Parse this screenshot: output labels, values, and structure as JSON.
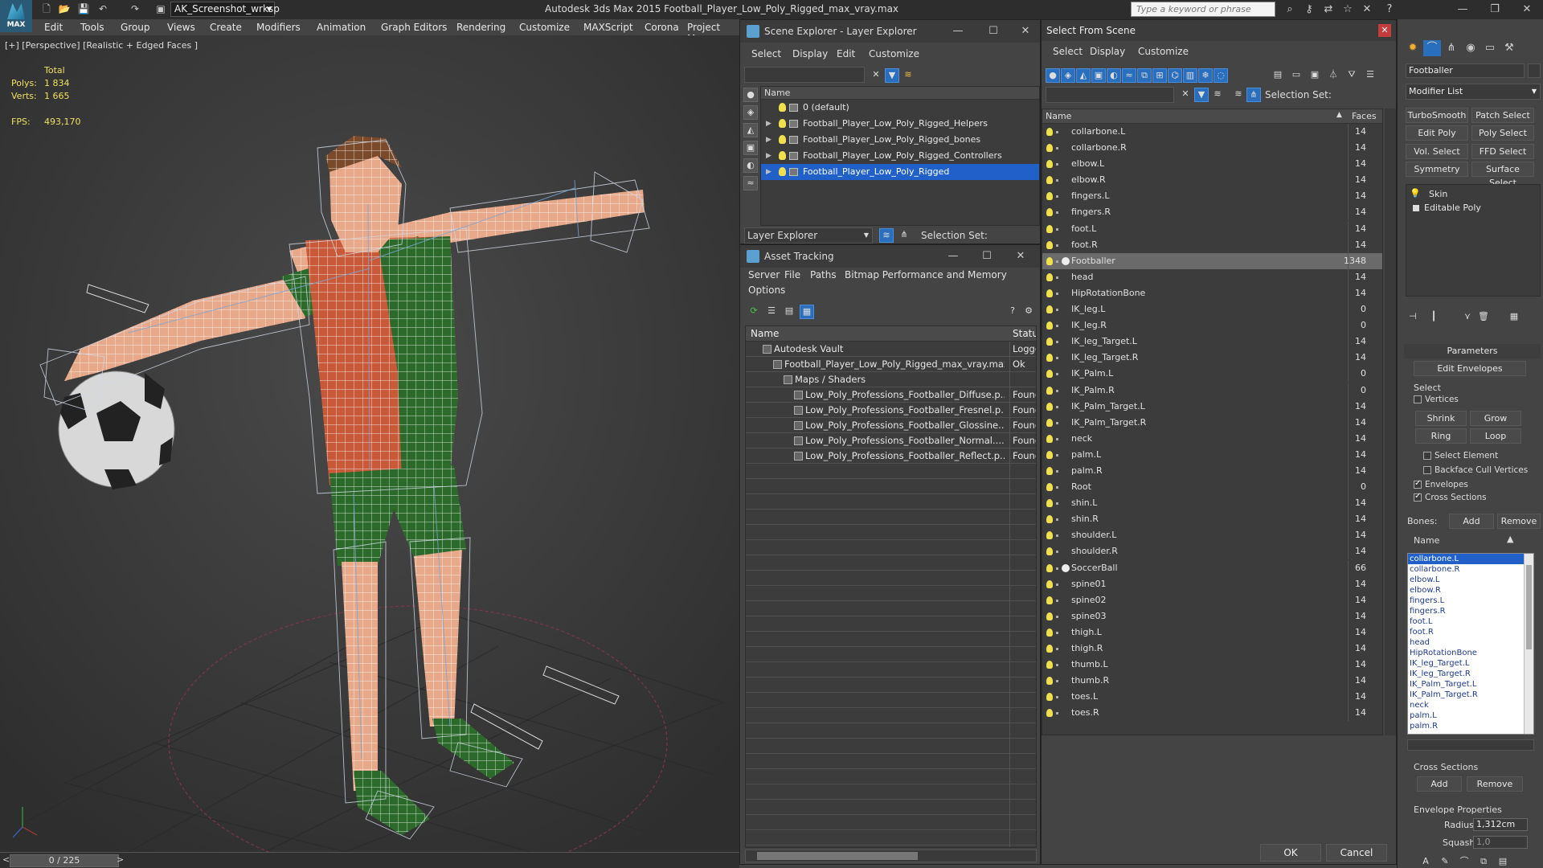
{
  "titlebar": {
    "logo_text": "MAX",
    "workspace": "AK_Screenshot_wrksp",
    "app_title": "Autodesk 3ds Max  2015     Football_Player_Low_Poly_Rigged_max_vray.max",
    "search_placeholder": "Type a keyword or phrase",
    "icons": [
      "binoculars-icon",
      "key-icon",
      "sign-in-icon",
      "star-icon",
      "x-icon",
      "help-icon"
    ],
    "window_controls": [
      "minimize",
      "restore",
      "close"
    ]
  },
  "menubar": [
    "Edit",
    "Tools",
    "Group",
    "Views",
    "Create",
    "Modifiers",
    "Animation",
    "Graph Editors",
    "Rendering",
    "Customize",
    "MAXScript",
    "Corona",
    "Project Man"
  ],
  "viewport": {
    "label": "[+] [Perspective] [Realistic + Edged Faces ]",
    "stats_total": "Total",
    "polys_label": "Polys:",
    "polys_value": "1 834",
    "verts_label": "Verts:",
    "verts_value": "1 665",
    "fps_label": "FPS:",
    "fps_value": "493,170"
  },
  "timeline": {
    "frame": "0 / 225",
    "prev": "<",
    "next": ">"
  },
  "scene_explorer": {
    "title": "Scene Explorer - Layer Explorer",
    "menus": [
      "Select",
      "Display",
      "Edit",
      "Customize"
    ],
    "column_name": "Name",
    "layers": [
      {
        "name": "0 (default)",
        "expandable": false,
        "selected": false
      },
      {
        "name": "Football_Player_Low_Poly_Rigged_Helpers",
        "expandable": true,
        "selected": false
      },
      {
        "name": "Football_Player_Low_Poly_Rigged_bones",
        "expandable": true,
        "selected": false
      },
      {
        "name": "Football_Player_Low_Poly_Rigged_Controllers",
        "expandable": true,
        "selected": false
      },
      {
        "name": "Football_Player_Low_Poly_Rigged",
        "expandable": true,
        "selected": true
      }
    ],
    "mode": "Layer Explorer",
    "selection_set_label": "Selection Set:"
  },
  "asset_tracking": {
    "title": "Asset Tracking",
    "menus_row1": [
      "Server",
      "File",
      "Paths",
      "Bitmap Performance and Memory"
    ],
    "menus_row2": [
      "Options"
    ],
    "col_name": "Name",
    "col_status": "Status",
    "rows": [
      {
        "name": "Autodesk Vault",
        "status": "Logge",
        "indent": 1
      },
      {
        "name": "Football_Player_Low_Poly_Rigged_max_vray.max",
        "status": "Ok",
        "indent": 2
      },
      {
        "name": "Maps / Shaders",
        "status": "",
        "indent": 3
      },
      {
        "name": "Low_Poly_Professions_Footballer_Diffuse.p...",
        "status": "Found",
        "indent": 4
      },
      {
        "name": "Low_Poly_Professions_Footballer_Fresnel.p...",
        "status": "Found",
        "indent": 4
      },
      {
        "name": "Low_Poly_Professions_Footballer_Glossine...",
        "status": "Found",
        "indent": 4
      },
      {
        "name": "Low_Poly_Professions_Footballer_Normal....",
        "status": "Found",
        "indent": 4
      },
      {
        "name": "Low_Poly_Professions_Footballer_Reflect.p...",
        "status": "Found",
        "indent": 4
      }
    ]
  },
  "select_from_scene": {
    "title": "Select From Scene",
    "menus": [
      "Select",
      "Display",
      "Customize"
    ],
    "selection_set_label": "Selection Set:",
    "col_name": "Name",
    "col_faces": "Faces",
    "objects": [
      {
        "name": "collarbone.L",
        "faces": "14"
      },
      {
        "name": "collarbone.R",
        "faces": "14"
      },
      {
        "name": "elbow.L",
        "faces": "14"
      },
      {
        "name": "elbow.R",
        "faces": "14"
      },
      {
        "name": "fingers.L",
        "faces": "14"
      },
      {
        "name": "fingers.R",
        "faces": "14"
      },
      {
        "name": "foot.L",
        "faces": "14"
      },
      {
        "name": "foot.R",
        "faces": "14"
      },
      {
        "name": "Footballer",
        "faces": "1348",
        "highlight": true
      },
      {
        "name": "head",
        "faces": "14"
      },
      {
        "name": "HipRotationBone",
        "faces": "14"
      },
      {
        "name": "IK_leg.L",
        "faces": "0"
      },
      {
        "name": "IK_leg.R",
        "faces": "0"
      },
      {
        "name": "IK_leg_Target.L",
        "faces": "14"
      },
      {
        "name": "IK_leg_Target.R",
        "faces": "14"
      },
      {
        "name": "IK_Palm.L",
        "faces": "0"
      },
      {
        "name": "IK_Palm.R",
        "faces": "0"
      },
      {
        "name": "IK_Palm_Target.L",
        "faces": "14"
      },
      {
        "name": "IK_Palm_Target.R",
        "faces": "14"
      },
      {
        "name": "neck",
        "faces": "14"
      },
      {
        "name": "palm.L",
        "faces": "14"
      },
      {
        "name": "palm.R",
        "faces": "14"
      },
      {
        "name": "Root",
        "faces": "0"
      },
      {
        "name": "shin.L",
        "faces": "14"
      },
      {
        "name": "shin.R",
        "faces": "14"
      },
      {
        "name": "shoulder.L",
        "faces": "14"
      },
      {
        "name": "shoulder.R",
        "faces": "14"
      },
      {
        "name": "SoccerBall",
        "faces": "66"
      },
      {
        "name": "spine01",
        "faces": "14"
      },
      {
        "name": "spine02",
        "faces": "14"
      },
      {
        "name": "spine03",
        "faces": "14"
      },
      {
        "name": "thigh.L",
        "faces": "14"
      },
      {
        "name": "thigh.R",
        "faces": "14"
      },
      {
        "name": "thumb.L",
        "faces": "14"
      },
      {
        "name": "thumb.R",
        "faces": "14"
      },
      {
        "name": "toes.L",
        "faces": "14"
      },
      {
        "name": "toes.R",
        "faces": "14"
      }
    ],
    "ok_label": "OK",
    "cancel_label": "Cancel"
  },
  "command_panel": {
    "object_name": "Footballer",
    "modifier_list": "Modifier List",
    "buttons": [
      "TurboSmooth",
      "Patch Select",
      "Edit Poly",
      "Poly Select",
      "Vol. Select",
      "FFD Select",
      "Symmetry",
      "Surface Select"
    ],
    "stack": [
      "Skin",
      "Editable Poly"
    ],
    "parameters_label": "Parameters",
    "edit_envelopes": "Edit Envelopes",
    "select_group": "Select",
    "vertices_label": "Vertices",
    "shrink": "Shrink",
    "grow": "Grow",
    "ring": "Ring",
    "loop": "Loop",
    "select_element": "Select Element",
    "backface_cull": "Backface Cull Vertices",
    "envelopes": "Envelopes",
    "cross_sections": "Cross Sections",
    "bones_label": "Bones:",
    "add": "Add",
    "remove": "Remove",
    "name_col": "Name",
    "bones": [
      "collarbone.L",
      "collarbone.R",
      "elbow.L",
      "elbow.R",
      "fingers.L",
      "fingers.R",
      "foot.L",
      "foot.R",
      "head",
      "HipRotationBone",
      "IK_leg_Target.L",
      "IK_leg_Target.R",
      "IK_Palm_Target.L",
      "IK_Palm_Target.R",
      "neck",
      "palm.L",
      "palm.R"
    ],
    "cross_sections_group": "Cross Sections",
    "envelope_props": "Envelope Properties",
    "radius_label": "Radius:",
    "radius_value": "1,312cm",
    "squash_label": "Squash:",
    "squash_value": "1,0"
  }
}
